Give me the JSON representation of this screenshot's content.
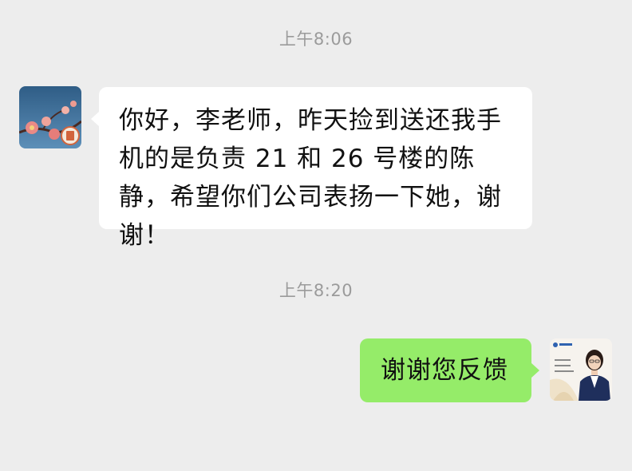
{
  "chat": {
    "messages": [
      {
        "time": "上午8:06",
        "direction": "incoming",
        "text": "你好，李老师，昨天捡到送还我手机的是负责 21 和 26 号楼的陈静，希望你们公司表扬一下她，谢谢！"
      },
      {
        "time": "上午8:20",
        "direction": "outgoing",
        "text": "谢谢您反馈"
      }
    ]
  },
  "colors": {
    "background": "#ededed",
    "incoming_bubble": "#ffffff",
    "outgoing_bubble": "#95ec69",
    "timestamp_text": "#9b9b9b"
  },
  "icons": {
    "incoming_avatar": "plum-blossom-avatar",
    "outgoing_avatar": "business-card-avatar"
  }
}
